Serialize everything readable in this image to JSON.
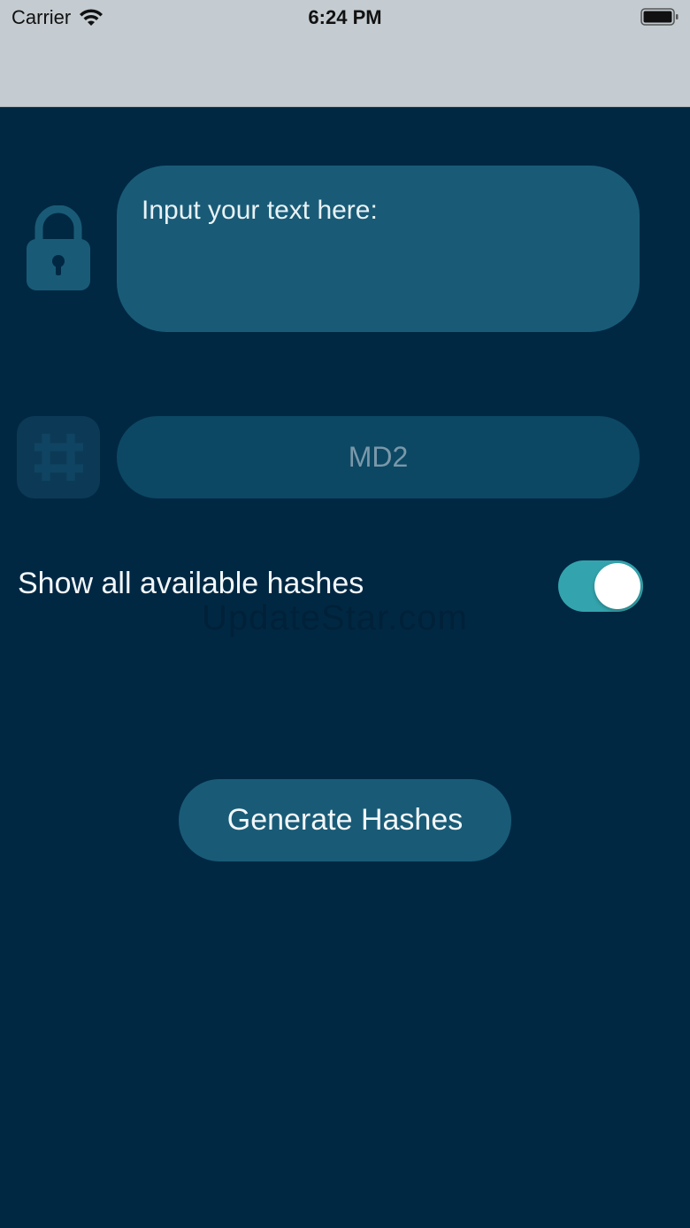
{
  "status_bar": {
    "carrier": "Carrier",
    "time": "6:24 PM"
  },
  "input": {
    "placeholder": "Input your text here:",
    "value": ""
  },
  "hash_selector": {
    "selected": "MD2"
  },
  "show_all": {
    "label": "Show all available hashes",
    "enabled": true
  },
  "watermark": "UpdateStar.com",
  "generate_button": {
    "label": "Generate Hashes"
  },
  "icons": {
    "input": "lock-icon",
    "hash": "hash-icon"
  },
  "colors": {
    "background": "#012843",
    "field": "#195b76",
    "field_dim": "#0c4863",
    "toggle_on": "#33a4ad",
    "icon": "#195b76"
  }
}
